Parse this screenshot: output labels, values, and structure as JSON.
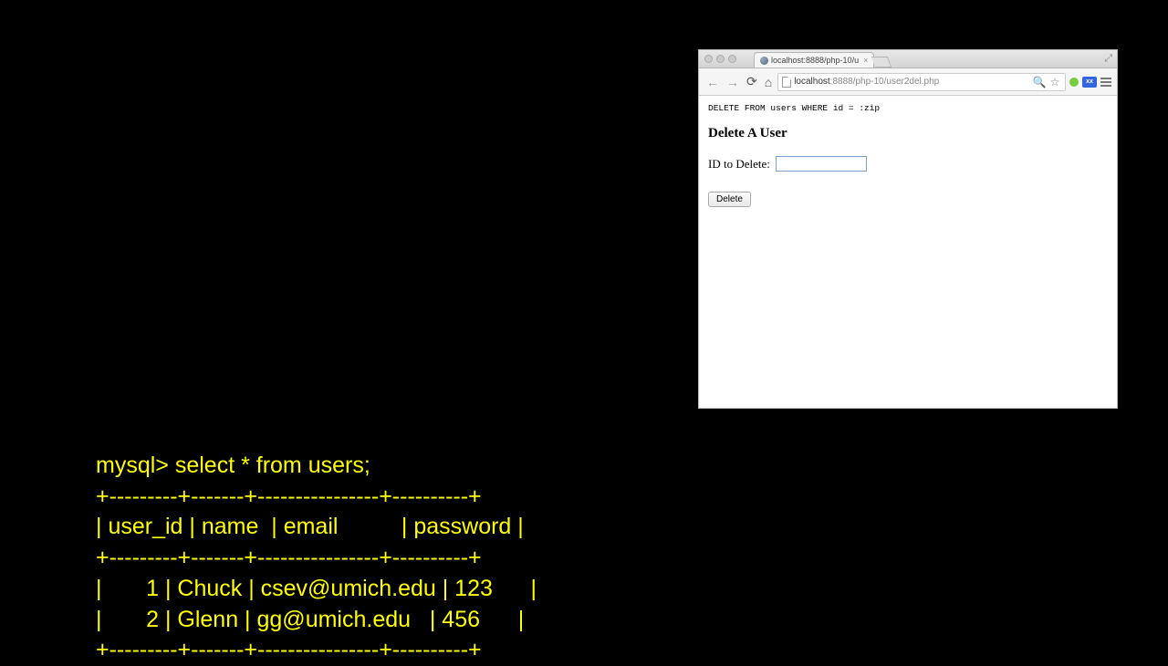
{
  "terminal": {
    "prompt": "mysql> select * from users;",
    "divider": "+---------+-------+----------------+----------+",
    "header": "| user_id | name  | email          | password |",
    "row1": "|       1 | Chuck | csev@umich.edu | 123      |",
    "row2": "|       2 | Glenn | gg@umich.edu   | 456      |"
  },
  "browser": {
    "tab_title": "localhost:8888/php-10/u",
    "url_host": "localhost",
    "url_rest": ":8888/php-10/user2del.php",
    "ext_blue_label": "xx"
  },
  "page": {
    "sql_echo": "DELETE FROM users WHERE id = :zip",
    "heading": "Delete A User",
    "label": "ID to Delete:",
    "input_value": "",
    "submit": "Delete"
  }
}
